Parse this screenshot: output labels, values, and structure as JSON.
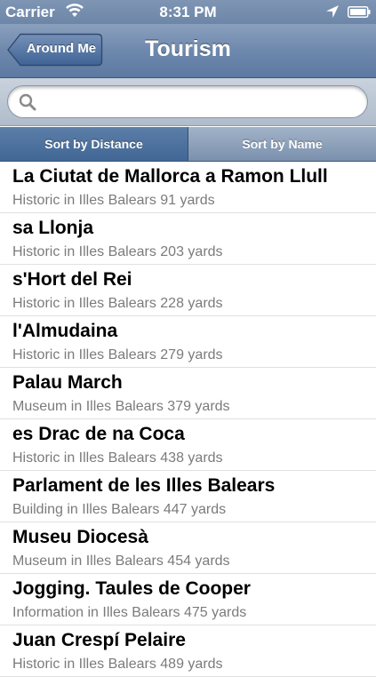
{
  "status_bar": {
    "carrier": "Carrier",
    "time": "8:31 PM",
    "icons": [
      "wifi-icon",
      "location-arrow-icon",
      "battery-icon"
    ]
  },
  "nav": {
    "back_label": "Around Me",
    "title": "Tourism"
  },
  "search": {
    "placeholder": "",
    "value": ""
  },
  "sort": {
    "options": [
      "Sort by Distance",
      "Sort by Name"
    ],
    "selected": "Sort by Distance"
  },
  "places": [
    {
      "name": "La Ciutat de Mallorca a Ramon Llull",
      "detail": "Historic in Illes Balears 91 yards"
    },
    {
      "name": "sa Llonja",
      "detail": "Historic in Illes Balears 203 yards"
    },
    {
      "name": "s'Hort del Rei",
      "detail": "Historic in Illes Balears 228 yards"
    },
    {
      "name": "l'Almudaina",
      "detail": "Historic in Illes Balears 279 yards"
    },
    {
      "name": "Palau March",
      "detail": "Museum in Illes Balears 379 yards"
    },
    {
      "name": "es Drac de na Coca",
      "detail": "Historic in Illes Balears 438 yards"
    },
    {
      "name": "Parlament de les Illes Balears",
      "detail": "Building in Illes Balears 447 yards"
    },
    {
      "name": "Museu Diocesà",
      "detail": "Museum in Illes Balears 454 yards"
    },
    {
      "name": "Jogging. Taules de Cooper",
      "detail": "Information in Illes Balears 475 yards"
    },
    {
      "name": "Juan Crespí Pelaire",
      "detail": "Historic in Illes Balears 489 yards"
    }
  ]
}
